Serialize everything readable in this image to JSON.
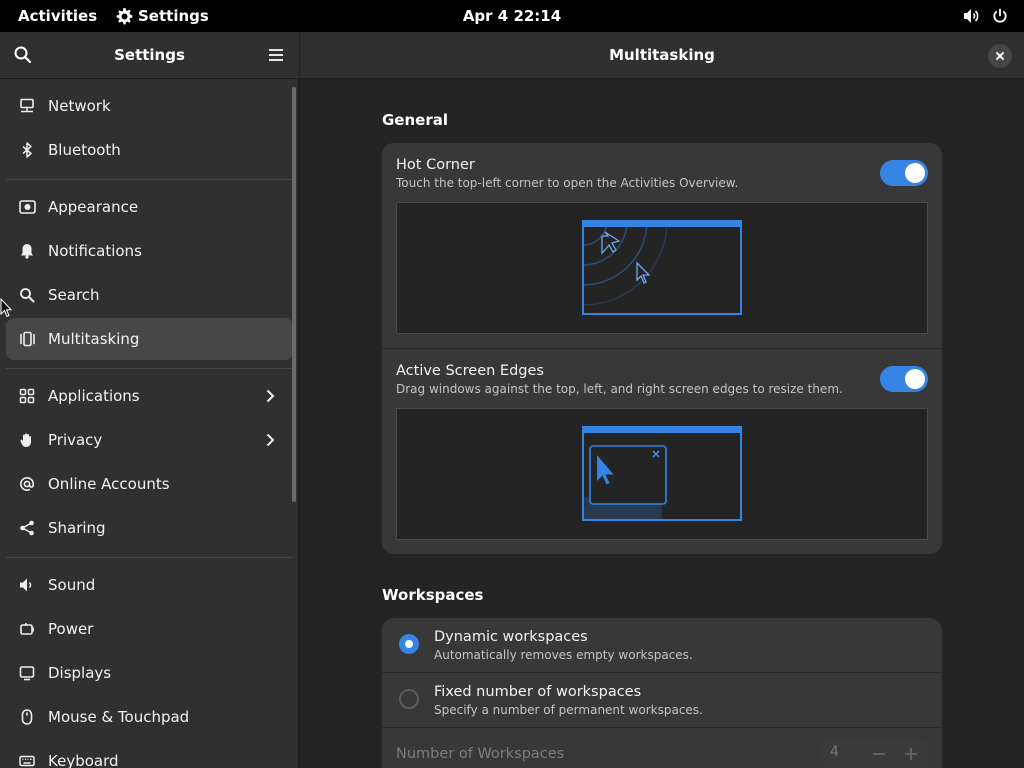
{
  "topbar": {
    "activities": "Activities",
    "app_name": "Settings",
    "clock": "Apr 4  22:14"
  },
  "sidebar": {
    "title": "Settings",
    "groups": [
      [
        {
          "label": "Network",
          "icon": "network-icon"
        },
        {
          "label": "Bluetooth",
          "icon": "bluetooth-icon"
        }
      ],
      [
        {
          "label": "Appearance",
          "icon": "appearance-icon"
        },
        {
          "label": "Notifications",
          "icon": "bell-icon"
        },
        {
          "label": "Search",
          "icon": "search-icon"
        },
        {
          "label": "Multitasking",
          "icon": "multitasking-icon",
          "active": true
        }
      ],
      [
        {
          "label": "Applications",
          "icon": "apps-grid-icon",
          "chevron": true
        },
        {
          "label": "Privacy",
          "icon": "hand-icon",
          "chevron": true
        },
        {
          "label": "Online Accounts",
          "icon": "at-icon"
        },
        {
          "label": "Sharing",
          "icon": "share-icon"
        }
      ],
      [
        {
          "label": "Sound",
          "icon": "speaker-icon"
        },
        {
          "label": "Power",
          "icon": "power-icon"
        },
        {
          "label": "Displays",
          "icon": "display-icon"
        },
        {
          "label": "Mouse & Touchpad",
          "icon": "mouse-icon"
        },
        {
          "label": "Keyboard",
          "icon": "keyboard-icon"
        }
      ]
    ]
  },
  "main": {
    "title": "Multitasking",
    "general": {
      "heading": "General",
      "hot_corner": {
        "title": "Hot Corner",
        "subtitle": "Touch the top-left corner to open the Activities Overview.",
        "enabled": true
      },
      "screen_edges": {
        "title": "Active Screen Edges",
        "subtitle": "Drag windows against the top, left, and right screen edges to resize them.",
        "enabled": true
      }
    },
    "workspaces": {
      "heading": "Workspaces",
      "dynamic": {
        "title": "Dynamic workspaces",
        "subtitle": "Automatically removes empty workspaces.",
        "selected": true
      },
      "fixed": {
        "title": "Fixed number of workspaces",
        "subtitle": "Specify a number of permanent workspaces.",
        "selected": false
      },
      "number": {
        "label": "Number of Workspaces",
        "value": "4"
      }
    }
  },
  "colors": {
    "accent": "#3584e4",
    "window_bg": "#242424",
    "sidebar_bg": "#303030",
    "card_bg": "#383838"
  }
}
